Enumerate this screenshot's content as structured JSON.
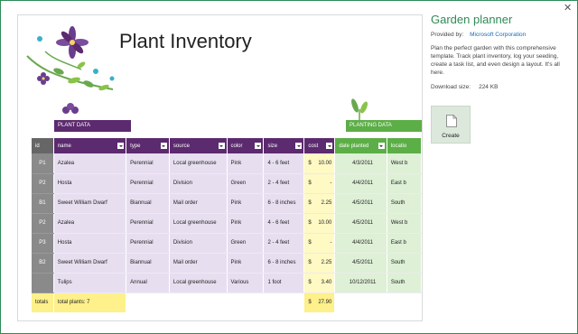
{
  "window": {
    "close_glyph": "✕"
  },
  "preview": {
    "title": "Plant Inventory",
    "plant_data_label": "PLANT DATA",
    "planting_data_label": "PLANTING DATA",
    "columns": [
      "id",
      "name",
      "type",
      "source",
      "color",
      "size",
      "cost",
      "date planted",
      "locatio"
    ],
    "rows": [
      {
        "id": "P1",
        "name": "Azalea",
        "type": "Perennial",
        "source": "Local greenhouse",
        "color": "Pink",
        "size": "4 - 6 feet",
        "cur": "$",
        "cost": "10.00",
        "date": "4/3/2011",
        "loc": "West b"
      },
      {
        "id": "P2",
        "name": "Hosta",
        "type": "Perennial",
        "source": "Division",
        "color": "Green",
        "size": "2 - 4 feet",
        "cur": "$",
        "cost": "-",
        "date": "4/4/2011",
        "loc": "East b"
      },
      {
        "id": "B1",
        "name": "Sweet William Dwarf",
        "type": "Biannual",
        "source": "Mail order",
        "color": "Pink",
        "size": "6 - 8 inches",
        "cur": "$",
        "cost": "2.25",
        "date": "4/5/2011",
        "loc": "South"
      },
      {
        "id": "P2",
        "name": "Azalea",
        "type": "Perennial",
        "source": "Local greenhouse",
        "color": "Pink",
        "size": "4 - 6 feet",
        "cur": "$",
        "cost": "10.00",
        "date": "4/5/2011",
        "loc": "West b"
      },
      {
        "id": "P3",
        "name": "Hosta",
        "type": "Perennial",
        "source": "Division",
        "color": "Green",
        "size": "2 - 4 feet",
        "cur": "$",
        "cost": "-",
        "date": "4/4/2011",
        "loc": "East b"
      },
      {
        "id": "B2",
        "name": "Sweet William Dwarf",
        "type": "Biannual",
        "source": "Mail order",
        "color": "Pink",
        "size": "6 - 8 inches",
        "cur": "$",
        "cost": "2.25",
        "date": "4/5/2011",
        "loc": "South"
      },
      {
        "id": "",
        "name": "Tulips",
        "type": "Annual",
        "source": "Local greenhouse",
        "color": "Various",
        "size": "1 foot",
        "cur": "$",
        "cost": "3.40",
        "date": "10/12/2011",
        "loc": "South"
      }
    ],
    "totals": {
      "label": "totals",
      "plants": "total plants: 7",
      "cur": "$",
      "cost": "27.90"
    }
  },
  "panel": {
    "title": "Garden planner",
    "provided_label": "Provided by:",
    "provider": "Microsoft Corporation",
    "description": "Plan the perfect garden with this comprehensive template. Track plant inventory, log your seeding, create a task list, and even design a layout. It's all here.",
    "download_label": "Download size:",
    "download_size": "224 KB",
    "create_label": "Create"
  },
  "colors": {
    "accent": "#2e8b57",
    "plant_header": "#5c2a6e",
    "planting_header": "#5cae46",
    "row_fill": "#e7dff0",
    "cost_fill": "#fff9c4",
    "total_fill": "#fef08a"
  }
}
